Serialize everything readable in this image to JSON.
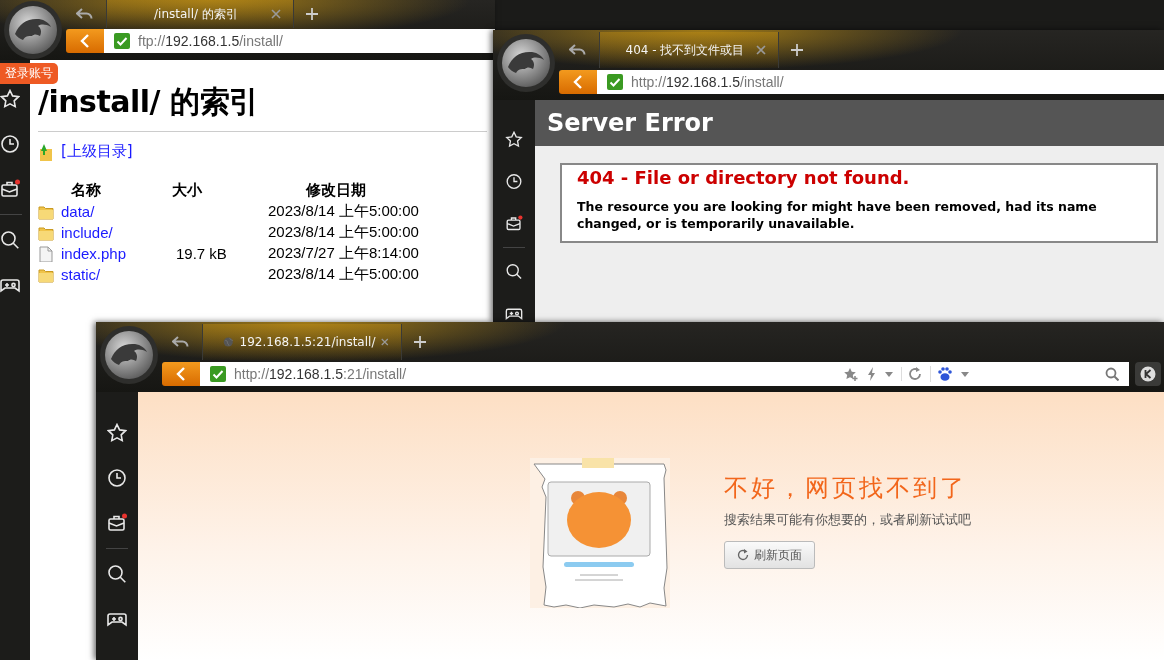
{
  "windows": [
    {
      "tabs": [
        {
          "title": "/install/ 的索引",
          "selected": true,
          "icon": false
        }
      ],
      "address": {
        "scheme": "ftp://",
        "host": "192.168.1.5",
        "path": "/install/"
      },
      "account_badge": "登录账号",
      "toolbar": false,
      "page": {
        "kind": "ftp_index",
        "heading": "/install/ 的索引",
        "parent_link": "[上级目录]",
        "columns": [
          "名称",
          "大小",
          "修改日期"
        ],
        "rows": [
          {
            "kind": "folder",
            "name": "data/",
            "date": "2023/8/14 上午5:00:00"
          },
          {
            "kind": "folder",
            "name": "include/",
            "date": "2023/8/14 上午5:00:00"
          },
          {
            "kind": "file",
            "name": "index.php",
            "size": "19.7 kB",
            "date": "2023/7/27 上午8:14:00"
          },
          {
            "kind": "folder",
            "name": "static/",
            "date": "2023/8/14 上午5:00:00"
          }
        ]
      }
    },
    {
      "tabs": [
        {
          "title": "404 - 找不到文件或目",
          "selected": true,
          "icon": false
        }
      ],
      "address": {
        "scheme": "http://",
        "host": "192.168.1.5",
        "path": "/install/"
      },
      "toolbar": false,
      "page": {
        "kind": "server_error",
        "header": "Server Error",
        "error_title": "404 - File or directory not found.",
        "message": "The resource you are looking for might have been removed, had its name changed, or is temporarily unavailable."
      }
    },
    {
      "tabs": [
        {
          "title": "192.168.1.5:21/install/",
          "selected": true,
          "icon": true
        }
      ],
      "address": {
        "scheme": "http://",
        "host": "192.168.1.5",
        "path": ":21/install/"
      },
      "toolbar": true,
      "page": {
        "kind": "not_found",
        "title": "不好，网页找不到了",
        "subtitle": "搜索结果可能有你想要的，或者刷新试试吧",
        "button": "刷新页面"
      }
    }
  ]
}
